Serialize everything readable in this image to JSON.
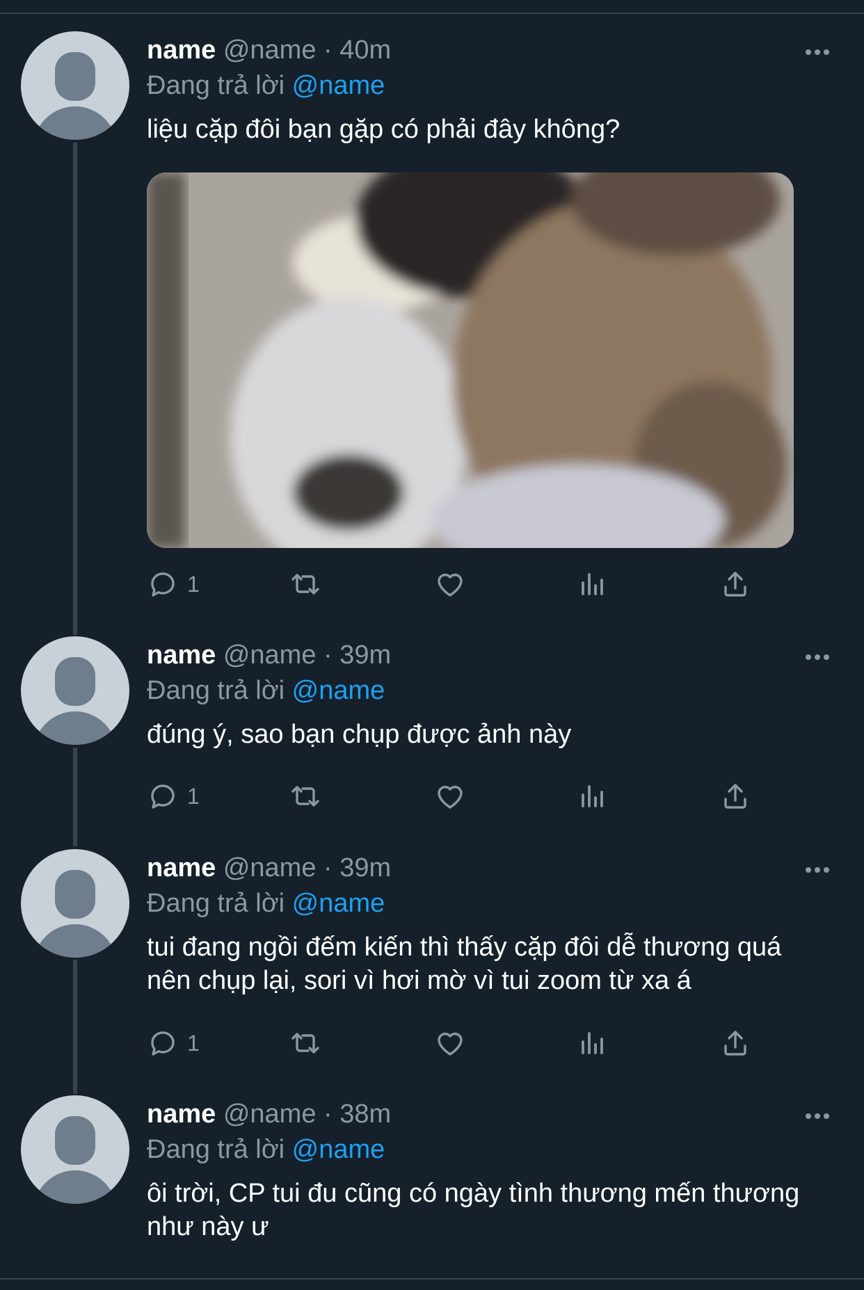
{
  "tweets": [
    {
      "name": "name",
      "handle": "@name",
      "sep": "·",
      "time": "40m",
      "reply_prefix": "Đang trả lời",
      "reply_to": "@name",
      "text": "liệu cặp đôi bạn gặp có phải đây không?",
      "has_media": true,
      "reply_count": "1"
    },
    {
      "name": "name",
      "handle": "@name",
      "sep": "·",
      "time": "39m",
      "reply_prefix": "Đang trả lời",
      "reply_to": "@name",
      "text": "đúng ý, sao bạn chụp được ảnh này",
      "reply_count": "1"
    },
    {
      "name": "name",
      "handle": "@name",
      "sep": "·",
      "time": "39m",
      "reply_prefix": "Đang trả lời",
      "reply_to": "@name",
      "text": "tui đang ngồi đếm kiến thì thấy cặp đôi dễ thương quá nên chụp lại, sori vì hơi mờ vì tui zoom từ xa á",
      "reply_count": "1"
    },
    {
      "name": "name",
      "handle": "@name",
      "sep": "·",
      "time": "38m",
      "reply_prefix": "Đang trả lời",
      "reply_to": "@name",
      "text": "ôi trời, CP tui đu cũng có ngày tình thương mến thương như này ư"
    }
  ],
  "icons": {
    "reply": "reply-icon",
    "retweet": "retweet-icon",
    "like": "heart-icon",
    "stats": "stats-icon",
    "share": "share-icon",
    "more": "more-icon"
  },
  "colors": {
    "background": "#15202b",
    "muted": "#8899a6",
    "accent": "#1da1f2",
    "divider": "#38444d"
  }
}
